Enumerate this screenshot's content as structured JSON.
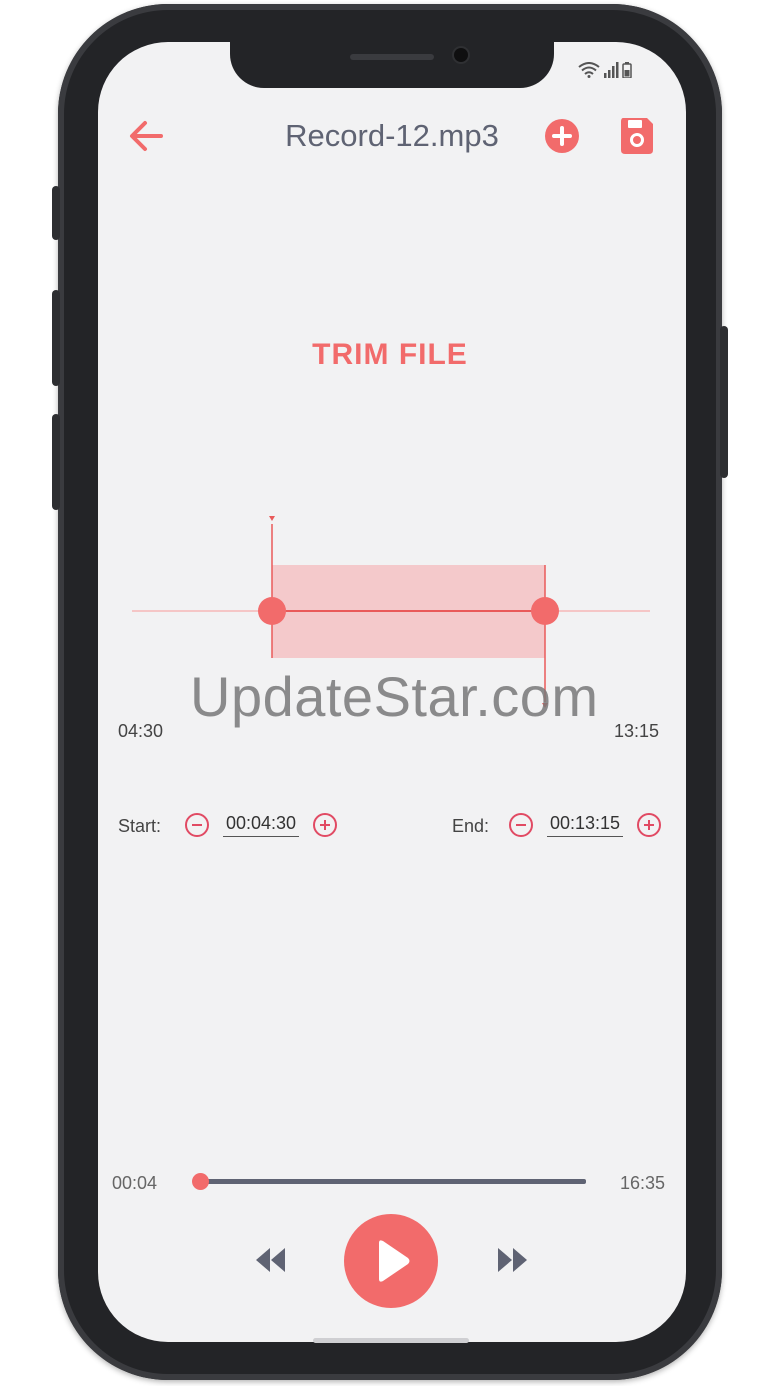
{
  "header": {
    "title": "Record-12.mp3",
    "back_icon": "arrow-left-icon",
    "add_icon": "plus-circle-icon",
    "save_icon": "floppy-save-icon"
  },
  "status_bar": {
    "icons": [
      "wifi-icon",
      "signal-icon",
      "battery-icon"
    ]
  },
  "trim": {
    "heading": "TRIM FILE",
    "range_start_label": "04:30",
    "range_end_label": "13:15",
    "start_label": "Start:",
    "start_value": "00:04:30",
    "end_label": "End:",
    "end_value": "00:13:15"
  },
  "player": {
    "elapsed": "00:04",
    "duration": "16:35",
    "progress_fraction": 0.004,
    "rewind_icon": "rewind-icon",
    "play_icon": "play-icon",
    "forward_icon": "fast-forward-icon"
  },
  "watermark": "UpdateStar.com",
  "colors": {
    "accent": "#F26B6B",
    "accent_dark": "#E14A63",
    "text": "#5F6373",
    "background": "#F2F2F3",
    "selection": "#F4C9CB"
  }
}
